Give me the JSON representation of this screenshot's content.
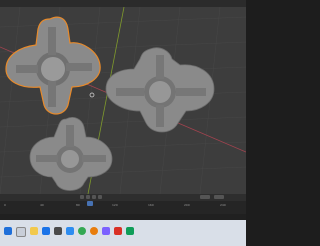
{
  "viewport": {
    "header_label": "",
    "colors": {
      "background": "#3d3d3d",
      "grid": "#4a4a4a",
      "axis_x": "#a3434f",
      "axis_y": "#7f9a2c",
      "object": "#8a8a8a",
      "selected_outline": "#e78a2b"
    }
  },
  "timeline": {
    "ruler_labels": [
      "0",
      "40",
      "80",
      "120",
      "160",
      "200",
      "240"
    ]
  },
  "taskbar": {
    "icons": [
      "start-icon",
      "search-icon",
      "explorer-icon",
      "browser-icon",
      "store-icon",
      "mail-icon",
      "chrome-icon",
      "blender-icon",
      "app-icon",
      "app-icon",
      "app-icon"
    ]
  }
}
